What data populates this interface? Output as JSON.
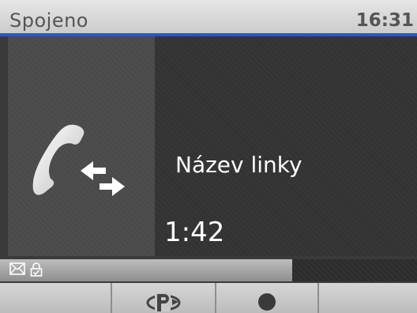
{
  "status": {
    "title": "Spojeno",
    "time": "16:31",
    "accent_color": "#2b57c6"
  },
  "call": {
    "icon": "call-transfer-icon",
    "line_name": "Název linky",
    "duration": "1:42"
  },
  "info_bar": {
    "icons": [
      "mail-icon",
      "lock-icon"
    ],
    "progress": 0.7
  },
  "softkeys": [
    {
      "name": "softkey-1",
      "icon": ""
    },
    {
      "name": "softkey-park",
      "icon": "park-icon"
    },
    {
      "name": "softkey-record",
      "icon": "record-icon"
    },
    {
      "name": "softkey-4",
      "icon": ""
    }
  ]
}
